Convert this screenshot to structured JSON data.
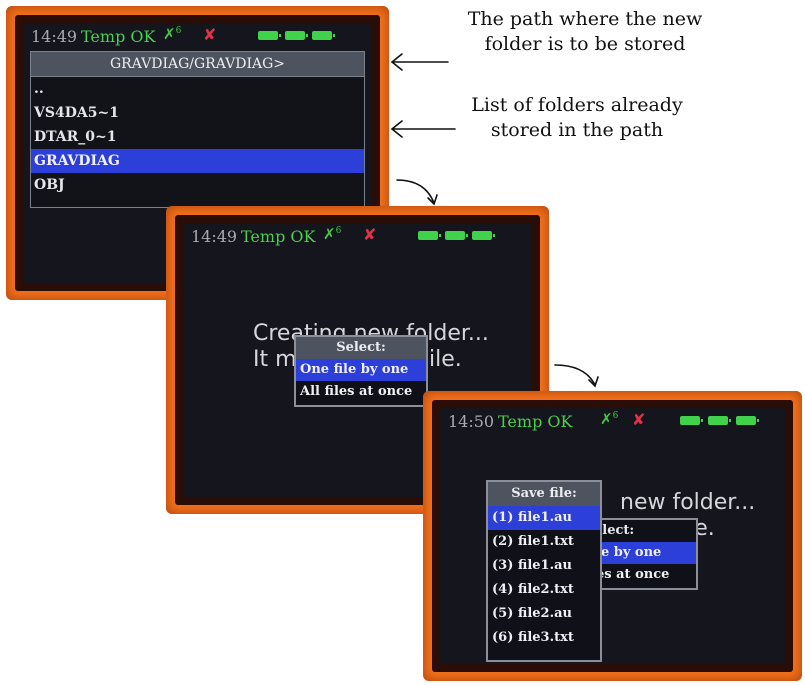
{
  "annotations": {
    "path_note": [
      "The path where the new",
      "folder is to be stored"
    ],
    "list_note": [
      "List of folders already",
      "stored in the path"
    ]
  },
  "status": {
    "screen1_time": "14:49",
    "screen2_time": "14:49",
    "screen3_time": "14:50",
    "temp": "Temp OK",
    "sat_symbol": "✗",
    "sat_count": "6",
    "no_signal_symbol": "✘"
  },
  "screen1": {
    "path": "GRAVDIAG/GRAVDIAG>",
    "items": [
      "..",
      "VS4DA5~1",
      "DTAR_0~1",
      "GRAVDIAG",
      "OBJ"
    ],
    "selected_index": 3
  },
  "screen2": {
    "line1": "Creating new folder...",
    "line2": "It m",
    "line2_tail": "ile.",
    "menu_title": "Select:",
    "menu_items": [
      "One file by one",
      "All files at once"
    ]
  },
  "screen3": {
    "line1_tail": "new folder...",
    "line2_tail": "ile.",
    "select_title": "elect:",
    "select_items": [
      "le by one",
      "es at once"
    ],
    "save_title": "Save file:",
    "save_items": [
      "(1) file1.au",
      "(2) file1.txt",
      "(3) file1.au",
      "(4) file2.txt",
      "(5) file2.au",
      "(6) file3.txt"
    ]
  },
  "colors": {
    "frame": "#f4721c",
    "selection": "#2d3fd9",
    "temp_ok": "#4bd04b",
    "battery": "#3fd24a",
    "no_signal": "#e2324a"
  }
}
